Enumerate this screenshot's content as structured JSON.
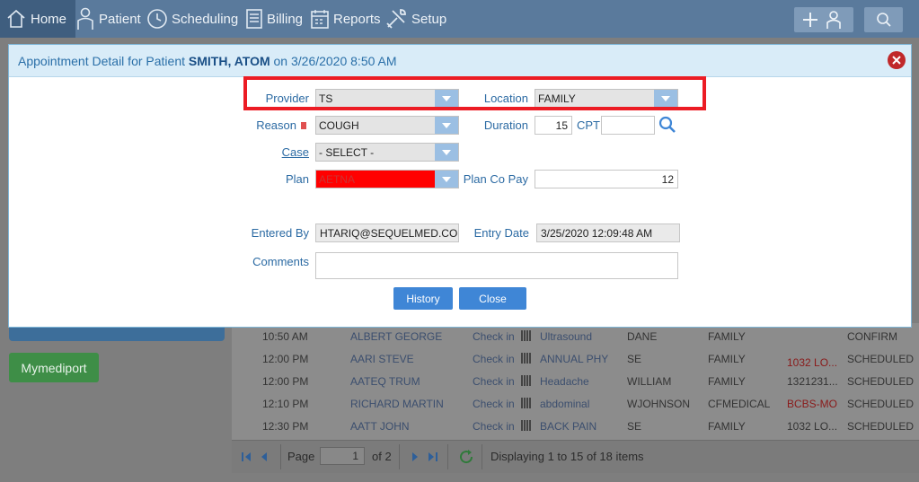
{
  "nav": {
    "items": [
      {
        "label": "Home",
        "icon": "home-icon"
      },
      {
        "label": "Patient",
        "icon": "patient-icon"
      },
      {
        "label": "Scheduling",
        "icon": "clock-icon"
      },
      {
        "label": "Billing",
        "icon": "billing-icon"
      },
      {
        "label": "Reports",
        "icon": "calendar-icon"
      },
      {
        "label": "Setup",
        "icon": "tools-icon"
      }
    ],
    "add_patient_icon": "add-patient-icon",
    "search_icon": "search-icon"
  },
  "dialog": {
    "title_prefix": "Appointment Detail for Patient ",
    "patient_name": "SMITH, ATOM",
    "title_suffix": " on 3/26/2020 8:50 AM",
    "provider_label": "Provider",
    "provider_value": "TS",
    "location_label": "Location",
    "location_value": "FAMILY",
    "reason_label": "Reason",
    "reason_value": "COUGH",
    "duration_label": "Duration",
    "duration_value": "15",
    "cpt_label": "CPT",
    "cpt_value": "",
    "case_label": "Case",
    "case_value": "- SELECT -",
    "plan_label": "Plan",
    "plan_value": "AETNA",
    "plan_copay_label": "Plan Co Pay",
    "plan_copay_value": "12",
    "entered_by_label": "Entered By",
    "entered_by_value": "HTARIQ@SEQUELMED.COM",
    "entry_date_label": "Entry Date",
    "entry_date_value": "3/25/2020 12:09:48 AM",
    "comments_label": "Comments",
    "comments_value": "",
    "history_button": "History",
    "close_button": "Close"
  },
  "background": {
    "mymediport_button": "Mymediport",
    "rows": [
      {
        "time": "10:50 AM",
        "patient": "ALBERT GEORGE",
        "checkin": "Check in",
        "reason": "Ultrasound",
        "provider": "DANE",
        "location": "FAMILY",
        "note": "",
        "status": "CONFIRM"
      },
      {
        "time": "12:00 PM",
        "patient": "AARI STEVE",
        "checkin": "Check in",
        "reason": "ANNUAL PHY",
        "provider": "SE",
        "location": "FAMILY",
        "note": "1032 LO...",
        "status": "SCHEDULED"
      },
      {
        "time": "12:00 PM",
        "patient": "AATEQ TRUM",
        "checkin": "Check in",
        "reason": "Headache",
        "provider": "WILLIAM",
        "location": "FAMILY",
        "note": "1321231...",
        "status": "SCHEDULED"
      },
      {
        "time": "12:10 PM",
        "patient": "RICHARD MARTIN",
        "checkin": "Check in",
        "reason": "abdominal",
        "provider": "WJOHNSON",
        "location": "CFMEDICAL",
        "note": "BCBS-MO",
        "status": "SCHEDULED"
      },
      {
        "time": "12:30 PM",
        "patient": "AATT JOHN",
        "checkin": "Check in",
        "reason": "BACK PAIN",
        "provider": "SE",
        "location": "FAMILY",
        "note": "1032 LO...",
        "status": "SCHEDULED"
      }
    ],
    "pager": {
      "page_label": "Page",
      "page_value": "1",
      "of_label": "of 2",
      "summary": "Displaying 1 to 15 of 18 items"
    }
  },
  "colors": {
    "accent": "#3f86d6",
    "highlight": "#ec1c24",
    "plan_bg": "#ff0000"
  }
}
